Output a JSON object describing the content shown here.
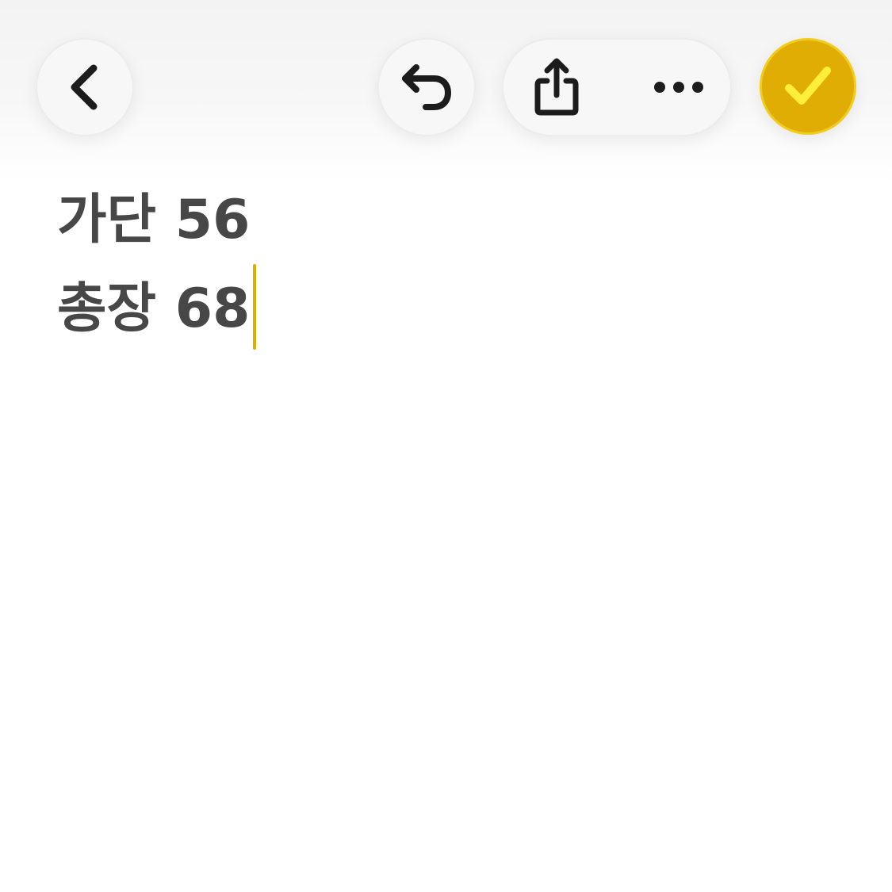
{
  "toolbar": {
    "back_icon": "chevron-left-icon",
    "undo_icon": "undo-icon",
    "share_icon": "share-icon",
    "more_icon": "ellipsis-icon",
    "done_icon": "checkmark-icon"
  },
  "note": {
    "lines": [
      "가단 56",
      "총장 68"
    ]
  },
  "colors": {
    "accent": "#e0ad05",
    "accent_check": "#ffef3a",
    "text": "#474747",
    "icon": "#1c1c1c"
  }
}
